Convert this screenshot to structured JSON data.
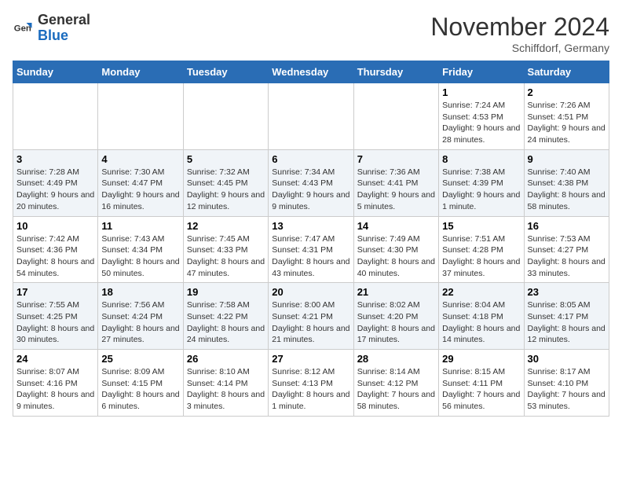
{
  "header": {
    "logo_line1": "General",
    "logo_line2": "Blue",
    "month_title": "November 2024",
    "location": "Schiffdorf, Germany"
  },
  "days_of_week": [
    "Sunday",
    "Monday",
    "Tuesday",
    "Wednesday",
    "Thursday",
    "Friday",
    "Saturday"
  ],
  "weeks": [
    [
      {
        "day": "",
        "info": ""
      },
      {
        "day": "",
        "info": ""
      },
      {
        "day": "",
        "info": ""
      },
      {
        "day": "",
        "info": ""
      },
      {
        "day": "",
        "info": ""
      },
      {
        "day": "1",
        "info": "Sunrise: 7:24 AM\nSunset: 4:53 PM\nDaylight: 9 hours and 28 minutes."
      },
      {
        "day": "2",
        "info": "Sunrise: 7:26 AM\nSunset: 4:51 PM\nDaylight: 9 hours and 24 minutes."
      }
    ],
    [
      {
        "day": "3",
        "info": "Sunrise: 7:28 AM\nSunset: 4:49 PM\nDaylight: 9 hours and 20 minutes."
      },
      {
        "day": "4",
        "info": "Sunrise: 7:30 AM\nSunset: 4:47 PM\nDaylight: 9 hours and 16 minutes."
      },
      {
        "day": "5",
        "info": "Sunrise: 7:32 AM\nSunset: 4:45 PM\nDaylight: 9 hours and 12 minutes."
      },
      {
        "day": "6",
        "info": "Sunrise: 7:34 AM\nSunset: 4:43 PM\nDaylight: 9 hours and 9 minutes."
      },
      {
        "day": "7",
        "info": "Sunrise: 7:36 AM\nSunset: 4:41 PM\nDaylight: 9 hours and 5 minutes."
      },
      {
        "day": "8",
        "info": "Sunrise: 7:38 AM\nSunset: 4:39 PM\nDaylight: 9 hours and 1 minute."
      },
      {
        "day": "9",
        "info": "Sunrise: 7:40 AM\nSunset: 4:38 PM\nDaylight: 8 hours and 58 minutes."
      }
    ],
    [
      {
        "day": "10",
        "info": "Sunrise: 7:42 AM\nSunset: 4:36 PM\nDaylight: 8 hours and 54 minutes."
      },
      {
        "day": "11",
        "info": "Sunrise: 7:43 AM\nSunset: 4:34 PM\nDaylight: 8 hours and 50 minutes."
      },
      {
        "day": "12",
        "info": "Sunrise: 7:45 AM\nSunset: 4:33 PM\nDaylight: 8 hours and 47 minutes."
      },
      {
        "day": "13",
        "info": "Sunrise: 7:47 AM\nSunset: 4:31 PM\nDaylight: 8 hours and 43 minutes."
      },
      {
        "day": "14",
        "info": "Sunrise: 7:49 AM\nSunset: 4:30 PM\nDaylight: 8 hours and 40 minutes."
      },
      {
        "day": "15",
        "info": "Sunrise: 7:51 AM\nSunset: 4:28 PM\nDaylight: 8 hours and 37 minutes."
      },
      {
        "day": "16",
        "info": "Sunrise: 7:53 AM\nSunset: 4:27 PM\nDaylight: 8 hours and 33 minutes."
      }
    ],
    [
      {
        "day": "17",
        "info": "Sunrise: 7:55 AM\nSunset: 4:25 PM\nDaylight: 8 hours and 30 minutes."
      },
      {
        "day": "18",
        "info": "Sunrise: 7:56 AM\nSunset: 4:24 PM\nDaylight: 8 hours and 27 minutes."
      },
      {
        "day": "19",
        "info": "Sunrise: 7:58 AM\nSunset: 4:22 PM\nDaylight: 8 hours and 24 minutes."
      },
      {
        "day": "20",
        "info": "Sunrise: 8:00 AM\nSunset: 4:21 PM\nDaylight: 8 hours and 21 minutes."
      },
      {
        "day": "21",
        "info": "Sunrise: 8:02 AM\nSunset: 4:20 PM\nDaylight: 8 hours and 17 minutes."
      },
      {
        "day": "22",
        "info": "Sunrise: 8:04 AM\nSunset: 4:18 PM\nDaylight: 8 hours and 14 minutes."
      },
      {
        "day": "23",
        "info": "Sunrise: 8:05 AM\nSunset: 4:17 PM\nDaylight: 8 hours and 12 minutes."
      }
    ],
    [
      {
        "day": "24",
        "info": "Sunrise: 8:07 AM\nSunset: 4:16 PM\nDaylight: 8 hours and 9 minutes."
      },
      {
        "day": "25",
        "info": "Sunrise: 8:09 AM\nSunset: 4:15 PM\nDaylight: 8 hours and 6 minutes."
      },
      {
        "day": "26",
        "info": "Sunrise: 8:10 AM\nSunset: 4:14 PM\nDaylight: 8 hours and 3 minutes."
      },
      {
        "day": "27",
        "info": "Sunrise: 8:12 AM\nSunset: 4:13 PM\nDaylight: 8 hours and 1 minute."
      },
      {
        "day": "28",
        "info": "Sunrise: 8:14 AM\nSunset: 4:12 PM\nDaylight: 7 hours and 58 minutes."
      },
      {
        "day": "29",
        "info": "Sunrise: 8:15 AM\nSunset: 4:11 PM\nDaylight: 7 hours and 56 minutes."
      },
      {
        "day": "30",
        "info": "Sunrise: 8:17 AM\nSunset: 4:10 PM\nDaylight: 7 hours and 53 minutes."
      }
    ]
  ]
}
